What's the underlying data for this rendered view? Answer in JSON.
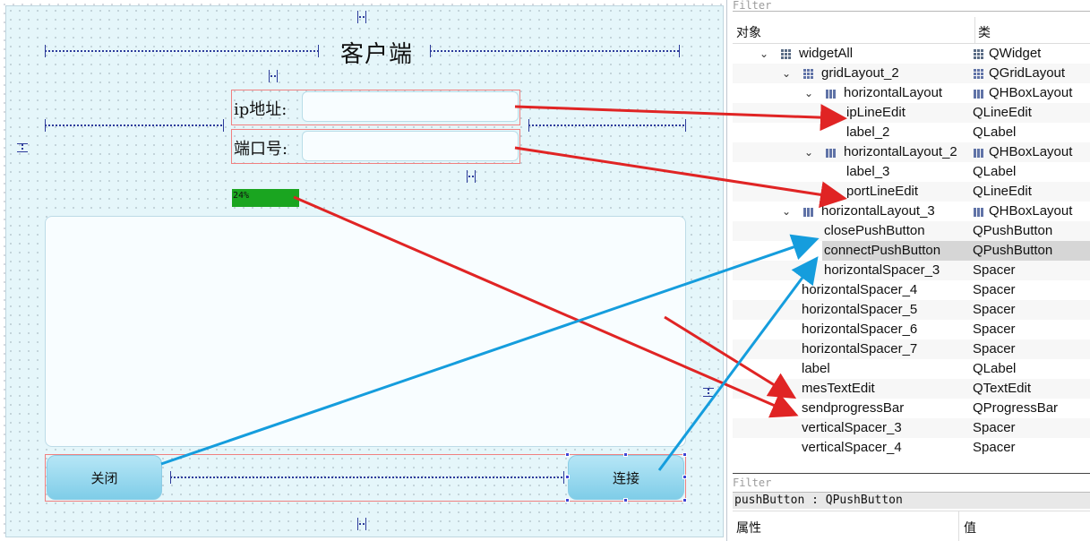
{
  "designer": {
    "title_label": "客户端",
    "ip_label": "ip地址:",
    "port_label": "端口号:",
    "ip_value": "",
    "port_value": "",
    "progress_text": "24%",
    "progress_value": 24,
    "close_button": "关闭",
    "connect_button": "连接"
  },
  "inspector": {
    "filter_top": "Filter",
    "header_object": "对象",
    "header_class": "类",
    "rows": [
      {
        "name": "widgetAll",
        "class": "QWidget",
        "arrow": "⌄",
        "icon": "widget-grid-icon",
        "class_icon": "widget-grid-icon"
      },
      {
        "name": "gridLayout_2",
        "class": "QGridLayout",
        "arrow": "⌄",
        "icon": "grid-layout-icon",
        "class_icon": "grid-layout-icon"
      },
      {
        "name": "horizontalLayout",
        "class": "QHBoxLayout",
        "arrow": "⌄",
        "icon": "hbox-layout-icon",
        "class_icon": "hbox-layout-icon"
      },
      {
        "name": "ipLineEdit",
        "class": "QLineEdit",
        "arrow": "",
        "icon": "",
        "class_icon": ""
      },
      {
        "name": "label_2",
        "class": "QLabel",
        "arrow": "",
        "icon": "",
        "class_icon": ""
      },
      {
        "name": "horizontalLayout_2",
        "class": "QHBoxLayout",
        "arrow": "⌄",
        "icon": "hbox-layout-icon",
        "class_icon": "hbox-layout-icon"
      },
      {
        "name": "label_3",
        "class": "QLabel",
        "arrow": "",
        "icon": "",
        "class_icon": ""
      },
      {
        "name": "portLineEdit",
        "class": "QLineEdit",
        "arrow": "",
        "icon": "",
        "class_icon": ""
      },
      {
        "name": "horizontalLayout_3",
        "class": "QHBoxLayout",
        "arrow": "⌄",
        "icon": "hbox-layout-icon",
        "class_icon": "hbox-layout-icon"
      },
      {
        "name": "closePushButton",
        "class": "QPushButton",
        "arrow": "",
        "icon": "",
        "class_icon": ""
      },
      {
        "name": "connectPushButton",
        "class": "QPushButton",
        "arrow": "",
        "icon": "",
        "class_icon": ""
      },
      {
        "name": "horizontalSpacer_3",
        "class": "Spacer",
        "arrow": "",
        "icon": "",
        "class_icon": ""
      },
      {
        "name": "horizontalSpacer_4",
        "class": "Spacer",
        "arrow": "",
        "icon": "",
        "class_icon": ""
      },
      {
        "name": "horizontalSpacer_5",
        "class": "Spacer",
        "arrow": "",
        "icon": "",
        "class_icon": ""
      },
      {
        "name": "horizontalSpacer_6",
        "class": "Spacer",
        "arrow": "",
        "icon": "",
        "class_icon": ""
      },
      {
        "name": "horizontalSpacer_7",
        "class": "Spacer",
        "arrow": "",
        "icon": "",
        "class_icon": ""
      },
      {
        "name": "label",
        "class": "QLabel",
        "arrow": "",
        "icon": "",
        "class_icon": ""
      },
      {
        "name": "mesTextEdit",
        "class": "QTextEdit",
        "arrow": "",
        "icon": "",
        "class_icon": ""
      },
      {
        "name": "sendprogressBar",
        "class": "QProgressBar",
        "arrow": "",
        "icon": "",
        "class_icon": ""
      },
      {
        "name": "verticalSpacer_3",
        "class": "Spacer",
        "arrow": "",
        "icon": "",
        "class_icon": ""
      },
      {
        "name": "verticalSpacer_4",
        "class": "Spacer",
        "arrow": "",
        "icon": "",
        "class_icon": ""
      }
    ],
    "filter_bottom": "Filter",
    "object_type": "pushButton : QPushButton",
    "props_name": "属性",
    "props_value": "值"
  },
  "colors": {
    "red_arrow": "#e02424",
    "blue_arrow": "#159ddd",
    "progress_fill": "#1aa520"
  }
}
